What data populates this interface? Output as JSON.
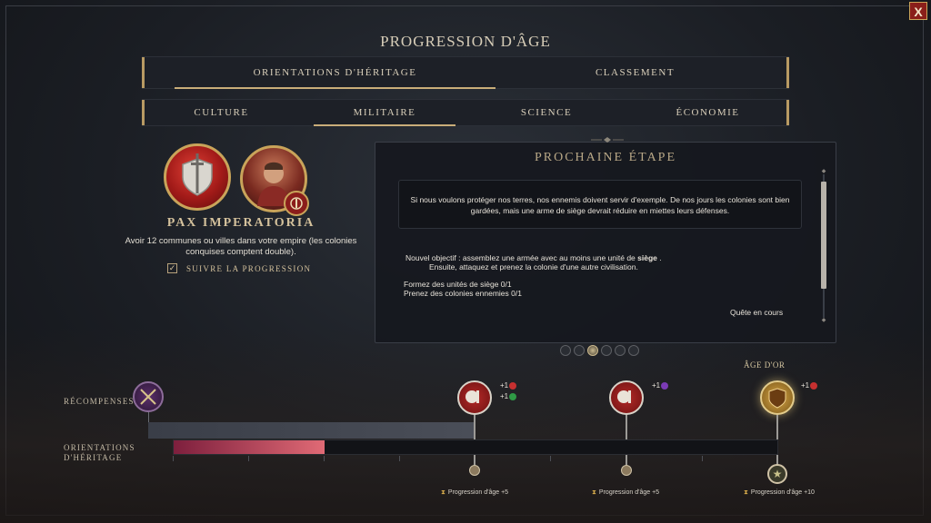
{
  "window": {
    "close_label": "X"
  },
  "page_title": "PROGRESSION D'ÂGE",
  "main_tabs": [
    {
      "label": "ORIENTATIONS D'HÉRITAGE",
      "active": true
    },
    {
      "label": "CLASSEMENT",
      "active": false
    }
  ],
  "sub_tabs": [
    {
      "label": "CULTURE",
      "active": false
    },
    {
      "label": "MILITAIRE",
      "active": true
    },
    {
      "label": "SCIENCE",
      "active": false
    },
    {
      "label": "ÉCONOMIE",
      "active": false
    }
  ],
  "legacy": {
    "title": "PAX IMPERATORIA",
    "description": "Avoir 12 communes ou villes dans votre empire (les colonies conquises comptent double).",
    "follow_label": "SUIVRE LA PROGRESSION",
    "follow_checked": true,
    "check_mark": "✓"
  },
  "next_step": {
    "title": "PROCHAINE ÉTAPE",
    "quote": "Si nous voulons protéger nos terres, nos ennemis doivent servir d'exemple. De nos jours les colonies sont bien gardées, mais une arme de siège devrait réduire en miettes leurs défenses.",
    "objective_prefix": "Nouvel objectif : assemblez une armée avec au moins une unité de ",
    "objective_bold": "siège",
    "objective_suffix": " .",
    "objective_line2": "Ensuite, attaquez et prenez la colonie d'une autre civilisation.",
    "tasks": [
      "Formez des unités de siège 0/1",
      "Prenez des colonies ennemies 0/1"
    ],
    "status": "Quête en cours"
  },
  "pagination": {
    "count": 6,
    "active_index": 2
  },
  "track": {
    "rewards_label": "RÉCOMPENSES",
    "legacy_label": "ORIENTATIONS D'HÉRITAGE",
    "progress_fraction": 0.25,
    "golden_age_label": "ÂGE D'OR",
    "milestones": [
      {
        "bonus_lines": [
          "+1",
          "+1"
        ],
        "progression_label": "Progression d'âge +5"
      },
      {
        "bonus_lines": [
          "+1"
        ],
        "progression_label": "Progression d'âge +5"
      },
      {
        "bonus_lines": [
          "+1"
        ],
        "progression_label": "Progression d'âge +10"
      }
    ]
  },
  "colors": {
    "accent_gold": "#c9ad79",
    "progress_start": "#7d1f3d",
    "progress_end": "#e06a75",
    "milestone_red": "#b42a28"
  },
  "icons": {
    "emblem": "shield-sword-emblem-icon",
    "leader": "leader-portrait",
    "reward": "crossed-swords-icon",
    "star": "star-icon"
  }
}
